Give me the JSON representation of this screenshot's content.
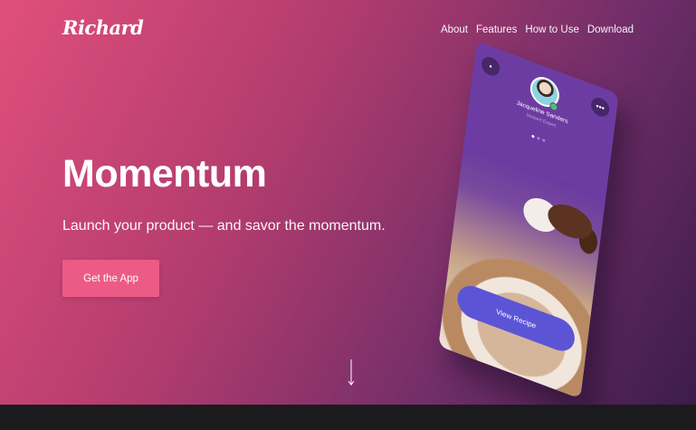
{
  "brand": {
    "logo": "Richard"
  },
  "nav": {
    "items": [
      {
        "label": "About"
      },
      {
        "label": "Features"
      },
      {
        "label": "How to Use"
      },
      {
        "label": "Download"
      }
    ]
  },
  "hero": {
    "title": "Momentum",
    "tagline": "Launch your product — and savor the momentum.",
    "cta_label": "Get the App"
  },
  "phone": {
    "back_icon": "•",
    "more_icon": "•••",
    "profile_name": "Jacqueline Sanders",
    "profile_role": "Dessert Expert",
    "button_label": "View Recipe"
  },
  "colors": {
    "gradient_start": "#e04f7c",
    "gradient_end": "#3c1c4a",
    "cta": "#ec5b85",
    "phone_bg": "#6a3aa0",
    "phone_button": "#5b55d6"
  }
}
